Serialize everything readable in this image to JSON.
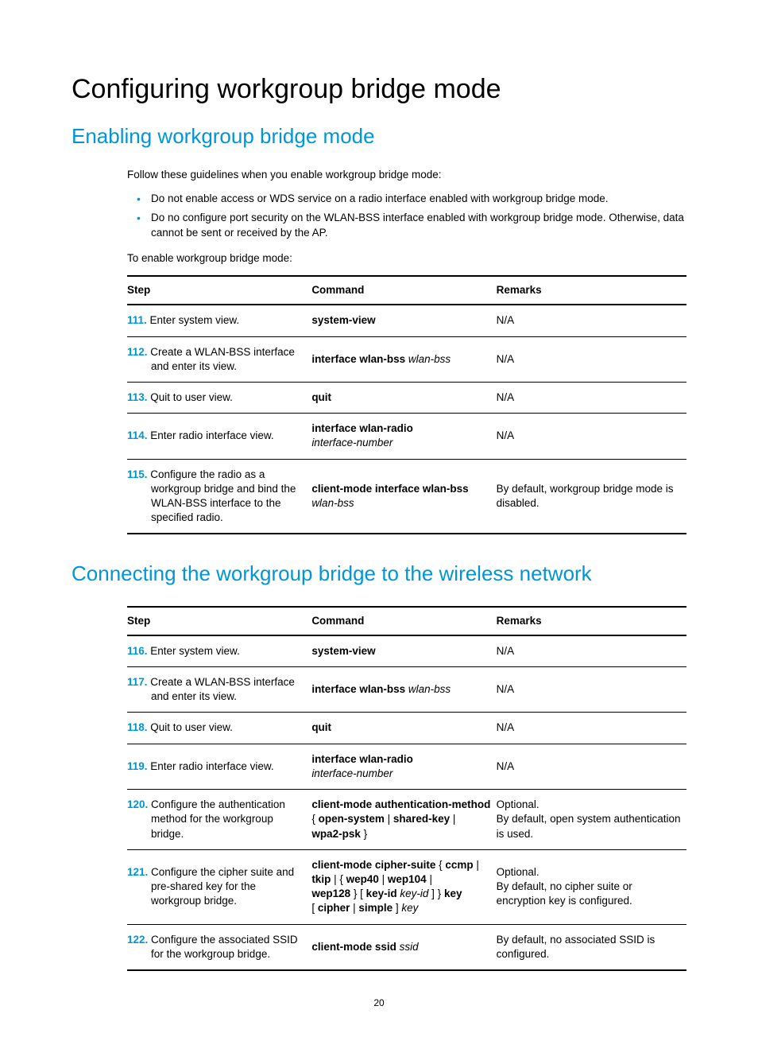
{
  "h1": "Configuring workgroup bridge mode",
  "h2a": "Enabling workgroup bridge mode",
  "intro": "Follow these guidelines when you enable workgroup bridge mode:",
  "bullets": [
    "Do not enable access or WDS service on a radio interface enabled with workgroup bridge mode.",
    "Do no configure port security on the WLAN-BSS interface enabled with workgroup bridge mode. Otherwise, data cannot be sent or received by the AP."
  ],
  "lead1": "To enable workgroup bridge mode:",
  "headers": {
    "step": "Step",
    "command": "Command",
    "remarks": "Remarks"
  },
  "t1": [
    {
      "num": "111.",
      "text": "Enter system view.",
      "cmd": [
        {
          "b": "system-view"
        }
      ],
      "rem": "N/A"
    },
    {
      "num": "112.",
      "text": "Create a WLAN-BSS interface and enter its view.",
      "cmd": [
        {
          "b": "interface wlan-bss "
        },
        {
          "i": "wlan-bss"
        }
      ],
      "rem": "N/A"
    },
    {
      "num": "113.",
      "text": "Quit to user view.",
      "cmd": [
        {
          "b": "quit"
        }
      ],
      "rem": "N/A"
    },
    {
      "num": "114.",
      "text": "Enter radio interface view.",
      "cmd": [
        {
          "b": "interface wlan-radio"
        },
        {
          "br": true
        },
        {
          "i": "interface-number"
        }
      ],
      "rem": "N/A"
    },
    {
      "num": "115.",
      "text": "Configure the radio as a workgroup bridge and bind the WLAN-BSS interface to the specified radio.",
      "cmd": [
        {
          "b": "client-mode interface wlan-bss"
        },
        {
          "br": true
        },
        {
          "i": "wlan-bss"
        }
      ],
      "rem": "By default, workgroup bridge mode is disabled."
    }
  ],
  "h2b": "Connecting the workgroup bridge to the wireless network",
  "t2": [
    {
      "num": "116.",
      "text": "Enter system view.",
      "cmd": [
        {
          "b": "system-view"
        }
      ],
      "rem": "N/A"
    },
    {
      "num": "117.",
      "text": "Create a WLAN-BSS interface and enter its view.",
      "cmd": [
        {
          "b": "interface wlan-bss "
        },
        {
          "i": "wlan-bss"
        }
      ],
      "rem": "N/A"
    },
    {
      "num": "118.",
      "text": "Quit to user view.",
      "cmd": [
        {
          "b": "quit"
        }
      ],
      "rem": "N/A"
    },
    {
      "num": "119.",
      "text": "Enter radio interface view.",
      "cmd": [
        {
          "b": "interface wlan-radio"
        },
        {
          "br": true
        },
        {
          "i": "interface-number"
        }
      ],
      "rem": "N/A"
    },
    {
      "num": "120.",
      "text": "Configure the authentication method for the workgroup bridge.",
      "cmd": [
        {
          "b": "client-mode authentication-method"
        },
        {
          "br": true
        },
        {
          "t": "{ "
        },
        {
          "b": "open-system"
        },
        {
          "t": " | "
        },
        {
          "b": "shared-key"
        },
        {
          "t": " | "
        },
        {
          "br": true
        },
        {
          "b": "wpa2-psk"
        },
        {
          "t": " }"
        }
      ],
      "rem": "Optional.\nBy default, open system authentication is used."
    },
    {
      "num": "121.",
      "text": "Configure the cipher suite and pre-shared key for the workgroup bridge.",
      "cmd": [
        {
          "b": "client-mode cipher-suite"
        },
        {
          "t": " { "
        },
        {
          "b": "ccmp"
        },
        {
          "t": " | "
        },
        {
          "br": true
        },
        {
          "b": "tkip"
        },
        {
          "t": " | { "
        },
        {
          "b": "wep40"
        },
        {
          "t": " | "
        },
        {
          "b": "wep104"
        },
        {
          "t": " | "
        },
        {
          "br": true
        },
        {
          "b": "wep128"
        },
        {
          "t": " } [ "
        },
        {
          "b": "key-id"
        },
        {
          "t": " "
        },
        {
          "i": "key-id"
        },
        {
          "t": " ] } "
        },
        {
          "b": "key"
        },
        {
          "br": true
        },
        {
          "t": "[ "
        },
        {
          "b": "cipher"
        },
        {
          "t": " | "
        },
        {
          "b": "simple"
        },
        {
          "t": " ] "
        },
        {
          "i": "key"
        }
      ],
      "rem": "Optional.\nBy default, no cipher suite or encryption key is configured."
    },
    {
      "num": "122.",
      "text": "Configure the associated SSID for the workgroup bridge.",
      "cmd": [
        {
          "b": "client-mode ssid "
        },
        {
          "i": "ssid"
        }
      ],
      "rem": "By default, no associated SSID is configured."
    }
  ],
  "pagenum": "20"
}
